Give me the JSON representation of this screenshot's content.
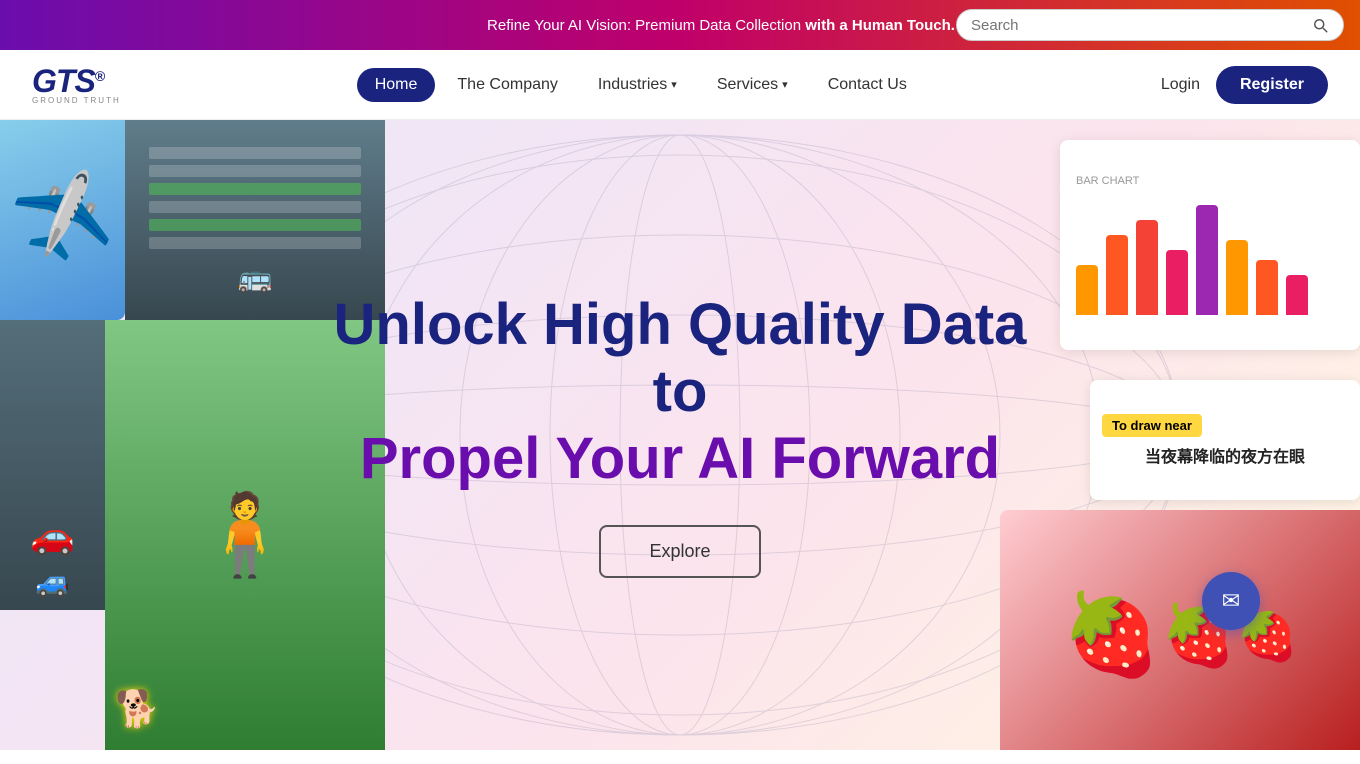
{
  "topBanner": {
    "text_normal": "Refine Your AI Vision: Premium Data Collection ",
    "text_bold": "with a Human Touch.",
    "search_placeholder": "Search"
  },
  "header": {
    "logo": {
      "text": "GTS",
      "superscript": "®",
      "tagline": "GROUND TRUTH"
    },
    "nav": [
      {
        "id": "home",
        "label": "Home",
        "active": true,
        "hasDropdown": false
      },
      {
        "id": "the-company",
        "label": "The Company",
        "active": false,
        "hasDropdown": false
      },
      {
        "id": "industries",
        "label": "Industries",
        "active": false,
        "hasDropdown": true
      },
      {
        "id": "services",
        "label": "Services",
        "active": false,
        "hasDropdown": true
      },
      {
        "id": "contact-us",
        "label": "Contact Us",
        "active": false,
        "hasDropdown": false
      }
    ],
    "login_label": "Login",
    "register_label": "Register"
  },
  "hero": {
    "title_line1": "Unlock High Quality Data to",
    "title_line2": "Propel Your AI Forward",
    "explore_label": "Explore",
    "chart": {
      "bars": [
        {
          "height": 50,
          "color": "#ff9800"
        },
        {
          "height": 80,
          "color": "#ff5722"
        },
        {
          "height": 95,
          "color": "#f44336"
        },
        {
          "height": 65,
          "color": "#e91e63"
        },
        {
          "height": 110,
          "color": "#9c27b0"
        }
      ]
    },
    "text_card": {
      "yellow_label": "To draw near",
      "chinese_text": "当夜幕降临的夜方在眼"
    }
  }
}
